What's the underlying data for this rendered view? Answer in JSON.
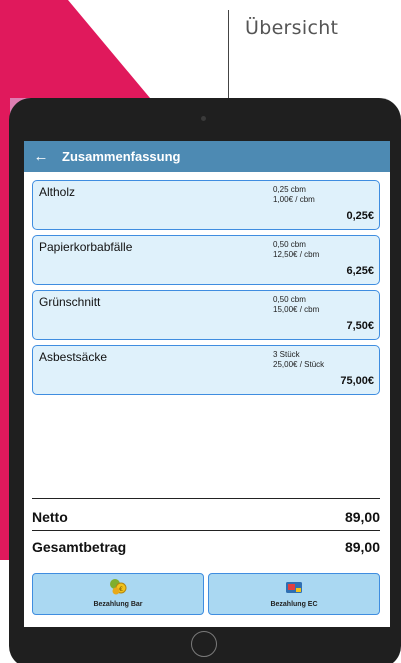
{
  "overview_label": "Übersicht",
  "app": {
    "back_icon": "←",
    "title": "Zusammenfassung"
  },
  "items": [
    {
      "name": "Altholz",
      "quantity": "0,25 cbm",
      "unit_price": "1,00€ / cbm",
      "total": "0,25€"
    },
    {
      "name": "Papierkorbabfälle",
      "quantity": "0,50 cbm",
      "unit_price": "12,50€ / cbm",
      "total": "6,25€"
    },
    {
      "name": "Grünschnitt",
      "quantity": "0,50 cbm",
      "unit_price": "15,00€ / cbm",
      "total": "7,50€"
    },
    {
      "name": "Asbestsäcke",
      "quantity": "3 Stück",
      "unit_price": "25,00€ / Stück",
      "total": "75,00€"
    }
  ],
  "summary": {
    "net_label": "Netto",
    "net_value": "89,00",
    "gross_label": "Gesamtbetrag",
    "gross_value": "89,00"
  },
  "payment": {
    "cash_label": "Bezahlung Bar",
    "cash_icon": "coins-icon",
    "ec_label": "Bezahlung EC",
    "ec_icon": "card-icon"
  },
  "colors": {
    "accent_pink": "#e0195c",
    "app_bar": "#4d8ab3",
    "card_border": "#3f8de0",
    "card_bg": "#dff1fb",
    "button_bg": "#aad8f2"
  }
}
